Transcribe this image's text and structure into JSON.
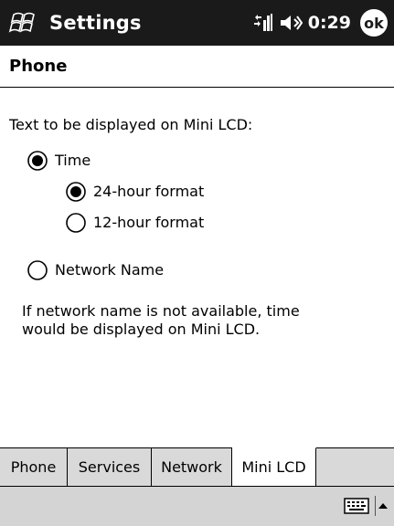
{
  "titlebar": {
    "title": "Settings",
    "time": "0:29",
    "ok_label": "ok",
    "icons": [
      "windows-start-icon",
      "signal-antenna-icon",
      "speaker-icon"
    ]
  },
  "page": {
    "title": "Phone"
  },
  "content": {
    "prompt": "Text to be displayed on Mini LCD:",
    "options": {
      "time": {
        "label": "Time",
        "selected": true
      },
      "format24": {
        "label": "24-hour format",
        "selected": true
      },
      "format12": {
        "label": "12-hour format",
        "selected": false
      },
      "network": {
        "label": "Network Name",
        "selected": false
      }
    },
    "note_line1": "If network name is not available, time",
    "note_line2": "would be displayed on Mini LCD."
  },
  "tabs": [
    {
      "label": "Phone",
      "active": false
    },
    {
      "label": "Services",
      "active": false
    },
    {
      "label": "Network",
      "active": false
    },
    {
      "label": "Mini LCD",
      "active": true
    }
  ],
  "cmdbar": {
    "icons": [
      "keyboard-icon",
      "up-arrow-icon"
    ]
  }
}
